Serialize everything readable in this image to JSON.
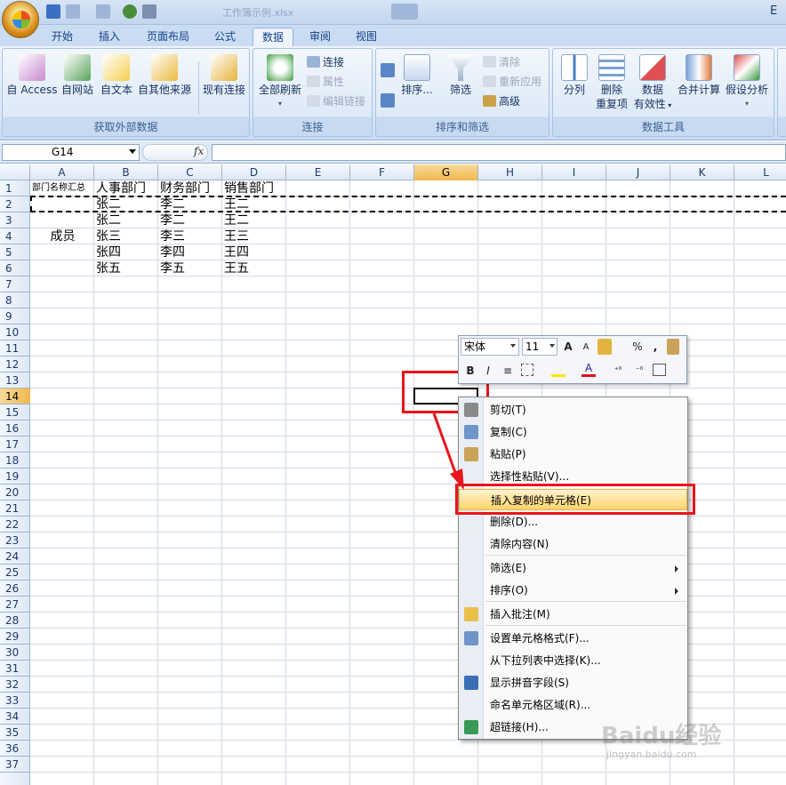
{
  "window": {
    "title": "工作簿示例.xlsx"
  },
  "ribbon_tabs": [
    "开始",
    "插入",
    "页面布局",
    "公式",
    "数据",
    "审阅",
    "视图"
  ],
  "active_tab": "数据",
  "groups": {
    "external": {
      "title": "获取外部数据",
      "buttons": [
        "自 Access",
        "自网站",
        "自文本",
        "自其他来源"
      ],
      "existing": "现有连接"
    },
    "connections": {
      "title": "连接",
      "refresh": "全部刷新",
      "connect": "连接",
      "properties": "属性",
      "edit_links": "编辑链接"
    },
    "sort_filter": {
      "title": "排序和筛选",
      "sort": "排序...",
      "filter": "筛选",
      "clear": "清除",
      "reapply": "重新应用",
      "advanced": "高级"
    },
    "data_tools": {
      "title": "数据工具",
      "split": "分列",
      "remove_dup_1": "删除",
      "remove_dup_2": "重复项",
      "validation_1": "数据",
      "validation_2": "有效性",
      "consolidate": "合并计算",
      "whatif": "假设分析"
    }
  },
  "formula_bar": {
    "name_box": "G14",
    "fx": "fx",
    "formula": ""
  },
  "columns": [
    "A",
    "B",
    "C",
    "D",
    "E",
    "F",
    "G",
    "H",
    "I",
    "J",
    "K",
    "L"
  ],
  "selected_column": "G",
  "rows": [
    "1",
    "2",
    "3",
    "4",
    "5",
    "6",
    "7",
    "8",
    "9",
    "10",
    "11",
    "12",
    "13",
    "14",
    "15",
    "16",
    "17",
    "18",
    "19",
    "20",
    "21",
    "22",
    "23",
    "24",
    "25",
    "26",
    "27",
    "28",
    "29",
    "30",
    "31",
    "32",
    "33",
    "34",
    "35",
    "36",
    "37"
  ],
  "selected_row": "14",
  "sheet": {
    "a1": "部门名称汇总",
    "a4": "成员",
    "headers": [
      "人事部门",
      "财务部门",
      "销售部门"
    ],
    "members": [
      [
        "张二",
        "李二",
        "王二"
      ],
      [
        "张二",
        "李二",
        "王二"
      ],
      [
        "张三",
        "李三",
        "王三"
      ],
      [
        "张四",
        "李四",
        "王四"
      ],
      [
        "张五",
        "李五",
        "王五"
      ]
    ]
  },
  "mini_toolbar": {
    "font": "宋体",
    "size": "11"
  },
  "context_menu": {
    "items": [
      {
        "label": "剪切(T)",
        "icon": "scissors-icon"
      },
      {
        "label": "复制(C)",
        "icon": "copy-icon"
      },
      {
        "label": "粘贴(P)",
        "icon": "paste-icon"
      },
      {
        "label": "选择性粘贴(V)...",
        "icon": ""
      },
      {
        "label": "插入复制的单元格(E)",
        "icon": "",
        "highlight": true
      },
      {
        "label": "删除(D)...",
        "icon": ""
      },
      {
        "label": "清除内容(N)",
        "icon": ""
      },
      {
        "label": "筛选(E)",
        "icon": "",
        "submenu": true
      },
      {
        "label": "排序(O)",
        "icon": "",
        "submenu": true
      },
      {
        "label": "插入批注(M)",
        "icon": "comment-icon"
      },
      {
        "label": "设置单元格格式(F)...",
        "icon": "format-cells-icon"
      },
      {
        "label": "从下拉列表中选择(K)...",
        "icon": ""
      },
      {
        "label": "显示拼音字段(S)",
        "icon": "phonetic-icon"
      },
      {
        "label": "命名单元格区域(R)...",
        "icon": ""
      },
      {
        "label": "超链接(H)...",
        "icon": "hyperlink-icon"
      }
    ]
  },
  "watermark": {
    "brand": "Baidu经验",
    "url": "jingyan.baidu.com"
  },
  "colors": {
    "accent": "#e8151b",
    "ribbon": "#dce8f7",
    "highlight": "#ffd36b"
  }
}
